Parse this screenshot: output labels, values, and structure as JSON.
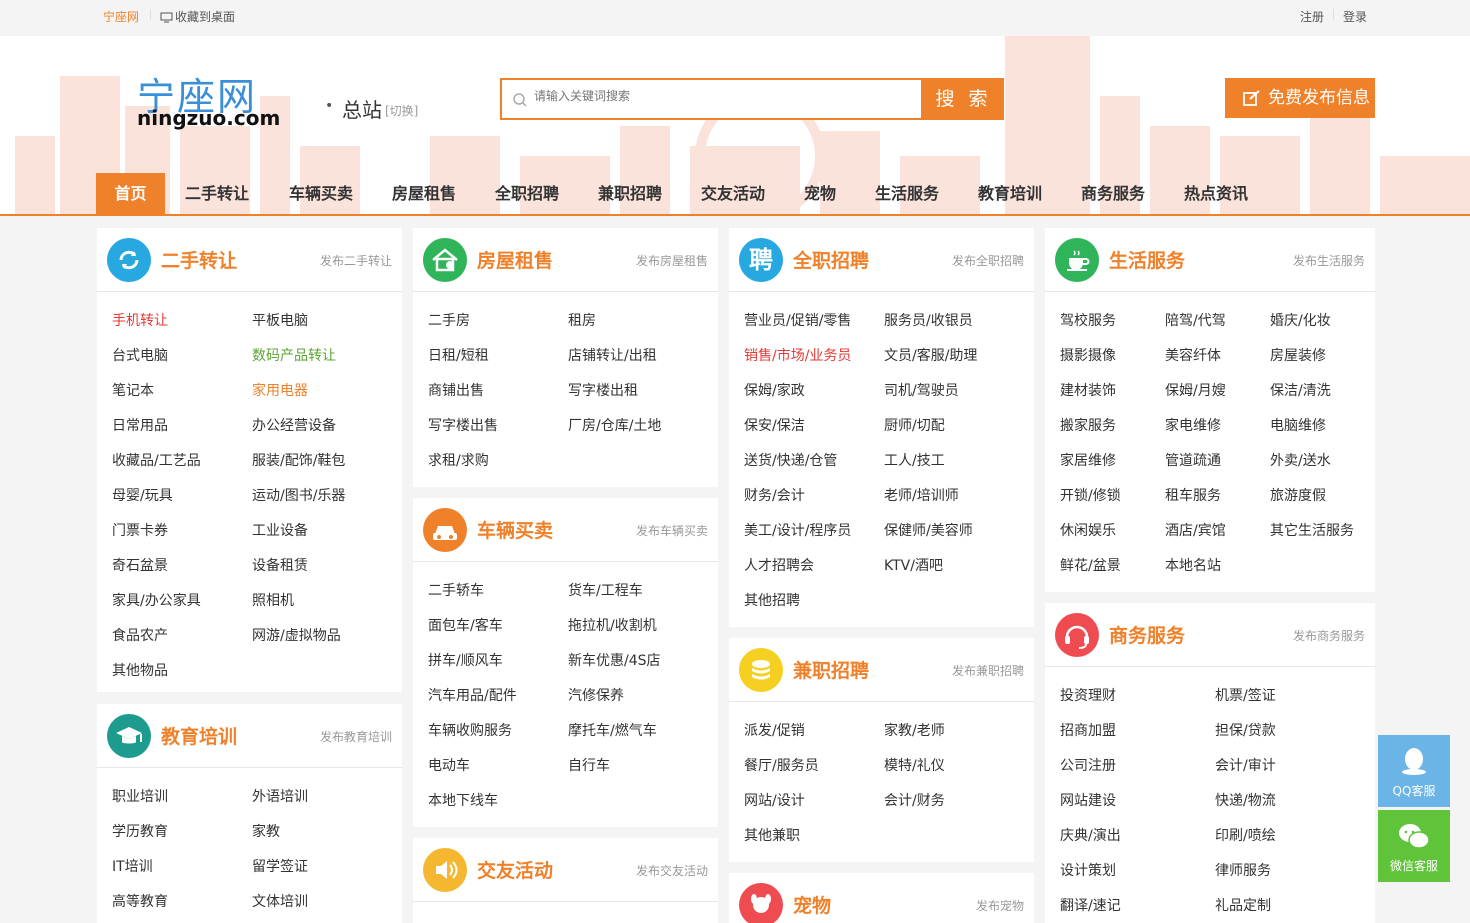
{
  "topbar": {
    "site_name": "宁座网",
    "favorite": "收藏到桌面",
    "register": "注册",
    "login": "登录"
  },
  "header": {
    "logo_cn": "宁座网",
    "logo_en": "ningzuo.com",
    "city": "总站",
    "switch": "[切换]",
    "search_placeholder": "请输入关键词搜索",
    "search_button": "搜 索",
    "post_button": "免费发布信息"
  },
  "nav": [
    "首页",
    "二手转让",
    "车辆买卖",
    "房屋租售",
    "全职招聘",
    "兼职招聘",
    "交友活动",
    "宠物",
    "生活服务",
    "教育培训",
    "商务服务",
    "热点资讯"
  ],
  "colors": {
    "accent": "#f0812b",
    "blue_icon": "#27a8e0",
    "green_icon": "#2fb45a",
    "teal_icon": "#1d9b8f",
    "red_icon": "#ef4c52",
    "yellow_icon": "#f5d020"
  },
  "cards": {
    "secondhand": {
      "title": "二手转让",
      "pub": "发布二手转让",
      "icon": "refresh-icon",
      "links": [
        "手机转让",
        "平板电脑",
        "台式电脑",
        "数码产品转让",
        "笔记本",
        "家用电器",
        "日常用品",
        "办公经营设备",
        "收藏品/工艺品",
        "服装/配饰/鞋包",
        "母婴/玩具",
        "运动/图书/乐器",
        "门票卡券",
        "工业设备",
        "奇石盆景",
        "设备租赁",
        "家具/办公家具",
        "照相机",
        "食品农产",
        "网游/虚拟物品",
        "其他物品"
      ]
    },
    "education": {
      "title": "教育培训",
      "pub": "发布教育培训",
      "icon": "graduation-cap-icon",
      "links": [
        "职业培训",
        "外语培训",
        "学历教育",
        "家教",
        "IT培训",
        "留学签证",
        "高等教育",
        "文体培训"
      ]
    },
    "house": {
      "title": "房屋租售",
      "pub": "发布房屋租售",
      "icon": "house-icon",
      "links": [
        "二手房",
        "租房",
        "日租/短租",
        "店铺转让/出租",
        "商铺出售",
        "写字楼出租",
        "写字楼出售",
        "厂房/仓库/土地",
        "求租/求购"
      ]
    },
    "car": {
      "title": "车辆买卖",
      "pub": "发布车辆买卖",
      "icon": "car-icon",
      "links": [
        "二手轿车",
        "货车/工程车",
        "面包车/客车",
        "拖拉机/收割机",
        "拼车/顺风车",
        "新车优惠/4S店",
        "汽车用品/配件",
        "汽修保养",
        "车辆收购服务",
        "摩托车/燃气车",
        "电动车",
        "自行车",
        "本地下线车"
      ]
    },
    "dating": {
      "title": "交友活动",
      "pub": "发布交友活动",
      "icon": "speaker-icon"
    },
    "fulltime": {
      "title": "全职招聘",
      "pub": "发布全职招聘",
      "icon_text": "聘",
      "links": [
        "营业员/促销/零售",
        "服务员/收银员",
        "销售/市场/业务员",
        "文员/客服/助理",
        "保姆/家政",
        "司机/驾驶员",
        "保安/保洁",
        "厨师/切配",
        "送货/快递/仓管",
        "工人/技工",
        "财务/会计",
        "老师/培训师",
        "美工/设计/程序员",
        "保健师/美容师",
        "人才招聘会",
        "KTV/酒吧",
        "其他招聘"
      ]
    },
    "parttime": {
      "title": "兼职招聘",
      "pub": "发布兼职招聘",
      "icon": "coins-icon",
      "links": [
        "派发/促销",
        "家教/老师",
        "餐厅/服务员",
        "模特/礼仪",
        "网站/设计",
        "会计/财务",
        "其他兼职"
      ]
    },
    "pet": {
      "title": "宠物",
      "pub": "发布宠物",
      "icon": "dog-icon"
    },
    "life": {
      "title": "生活服务",
      "pub": "发布生活服务",
      "icon": "cup-icon",
      "links": [
        "驾校服务",
        "陪驾/代驾",
        "婚庆/化妆",
        "摄影摄像",
        "美容纤体",
        "房屋装修",
        "建材装饰",
        "保姆/月嫂",
        "保洁/清洗",
        "搬家服务",
        "家电维修",
        "电脑维修",
        "家居维修",
        "管道疏通",
        "外卖/送水",
        "开锁/修锁",
        "租车服务",
        "旅游度假",
        "休闲娱乐",
        "酒店/宾馆",
        "其它生活服务",
        "鲜花/盆景",
        "本地名站"
      ]
    },
    "business": {
      "title": "商务服务",
      "pub": "发布商务服务",
      "icon": "headset-icon",
      "links": [
        "投资理财",
        "机票/签证",
        "招商加盟",
        "担保/贷款",
        "公司注册",
        "会计/审计",
        "网站建设",
        "快递/物流",
        "庆典/演出",
        "印刷/喷绘",
        "设计策划",
        "律师服务",
        "翻译/速记",
        "礼品定制"
      ]
    }
  },
  "float": {
    "qq": "QQ客服",
    "wechat": "微信客服"
  }
}
